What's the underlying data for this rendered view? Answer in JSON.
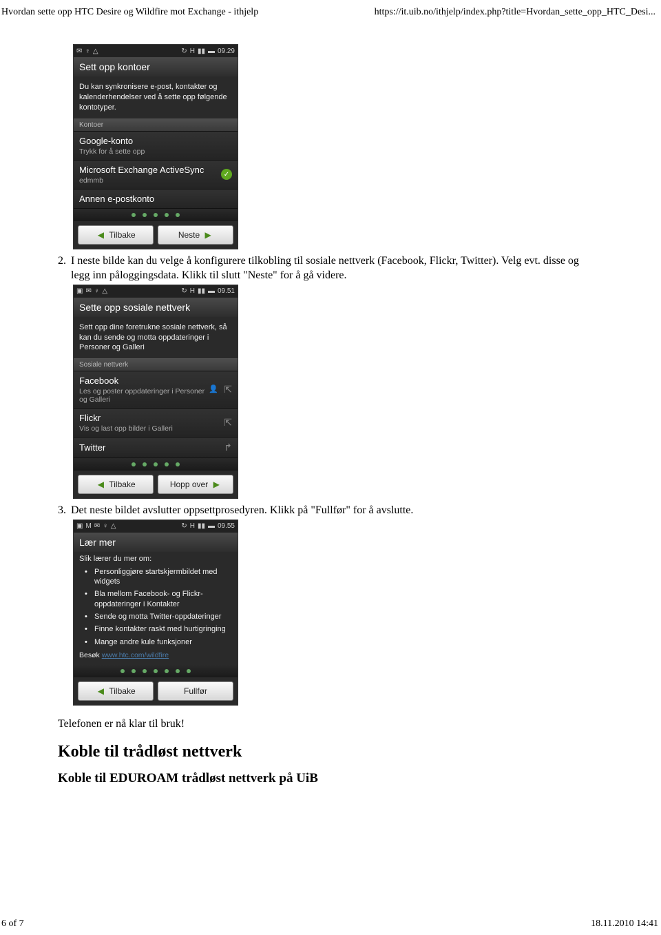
{
  "header": {
    "left": "Hvordan sette opp HTC Desire og Wildfire mot Exchange - ithjelp",
    "right": "https://it.uib.no/ithjelp/index.php?title=Hvordan_sette_opp_HTC_Desi..."
  },
  "step2": {
    "num": "2.",
    "text": "I neste bilde kan du velge å konfigurere tilkobling til sosiale nettverk (Facebook, Flickr, Twitter). Velg evt. disse og legg inn påloggingsdata. Klikk til slutt \"Neste\" for å gå videre."
  },
  "step3": {
    "num": "3.",
    "text": "Det neste bildet avslutter oppsettprosedyren. Klikk på \"Fullfør\" for å avslutte."
  },
  "phone1": {
    "time": "09.29",
    "title": "Sett opp kontoer",
    "sub": "Du kan synkronisere e-post, kontakter og kalenderhendelser ved å sette opp følgende kontotyper.",
    "section_label": "Kontoer",
    "accounts": [
      {
        "title": "Google-konto",
        "sub": "Trykk for å sette opp"
      },
      {
        "title": "Microsoft Exchange ActiveSync",
        "sub": "edmmb"
      },
      {
        "title": "Annen e-postkonto",
        "sub": ""
      }
    ],
    "btn_back": "Tilbake",
    "btn_next": "Neste"
  },
  "phone2": {
    "time": "09.51",
    "title": "Sette opp sosiale nettverk",
    "sub": "Sett opp dine foretrukne sosiale nettverk, så kan du sende og motta oppdateringer i Personer og Galleri",
    "section_label": "Sosiale nettverk",
    "accounts": [
      {
        "title": "Facebook",
        "sub": "Les og poster oppdateringer i Personer og Galleri"
      },
      {
        "title": "Flickr",
        "sub": "Vis og last opp bilder i Galleri"
      },
      {
        "title": "Twitter",
        "sub": ""
      }
    ],
    "btn_back": "Tilbake",
    "btn_skip": "Hopp over"
  },
  "phone3": {
    "time": "09.55",
    "title": "Lær mer",
    "intro": "Slik lærer du mer om:",
    "items": [
      "Personliggjøre startskjermbildet med widgets",
      "Bla mellom Facebook- og Flickr-oppdateringer i Kontakter",
      "Sende og motta Twitter-oppdateringer",
      "Finne kontakter raskt med hurtigringing",
      "Mange andre kule funksjoner"
    ],
    "visit_label": "Besøk",
    "visit_link": "www.htc.com/wildfire",
    "btn_back": "Tilbake",
    "btn_done": "Fullfør"
  },
  "conclusion": "Telefonen er nå klar til bruk!",
  "h2": "Koble til trådløst nettverk",
  "h3": "Koble til EDUROAM trådløst nettverk på UiB",
  "footer": {
    "left": "6 of 7",
    "right": "18.11.2010 14:41"
  }
}
